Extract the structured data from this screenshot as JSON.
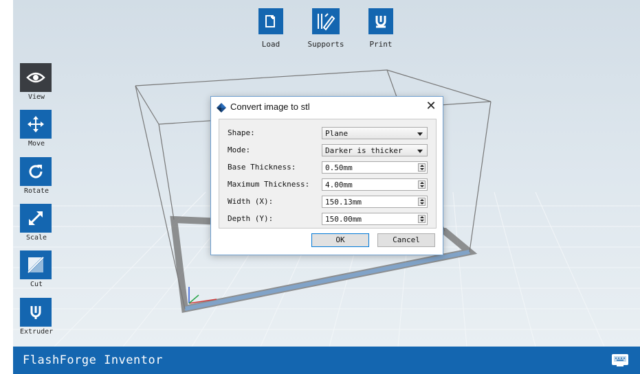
{
  "app": {
    "title": "FlashForge Inventor"
  },
  "toolbar": {
    "load_label": "Load",
    "supports_label": "Supports",
    "print_label": "Print"
  },
  "sidebar": {
    "items": [
      {
        "label": "View",
        "icon": "eye-icon",
        "active": true
      },
      {
        "label": "Move",
        "icon": "move-arrows-icon"
      },
      {
        "label": "Rotate",
        "icon": "rotate-icon"
      },
      {
        "label": "Scale",
        "icon": "scale-arrow-icon"
      },
      {
        "label": "Cut",
        "icon": "cut-icon"
      },
      {
        "label": "Extruder",
        "icon": "extruder-icon"
      }
    ]
  },
  "dialog": {
    "title": "Convert image to stl",
    "fields": [
      {
        "label": "Shape:",
        "value": "Plane",
        "kind": "select"
      },
      {
        "label": "Mode:",
        "value": "Darker is thicker",
        "kind": "select"
      },
      {
        "label": "Base Thickness:",
        "value": "0.50mm",
        "kind": "spin"
      },
      {
        "label": "Maximum Thickness:",
        "value": "4.00mm",
        "kind": "spin"
      },
      {
        "label": "Width (X):",
        "value": "150.13mm",
        "kind": "spin"
      },
      {
        "label": "Depth (Y):",
        "value": "150.00mm",
        "kind": "spin"
      }
    ],
    "ok_label": "OK",
    "cancel_label": "Cancel"
  },
  "colors": {
    "accent": "#1466b0",
    "active_tool": "#3a3d42",
    "dialog_border": "#6f9fcf"
  }
}
